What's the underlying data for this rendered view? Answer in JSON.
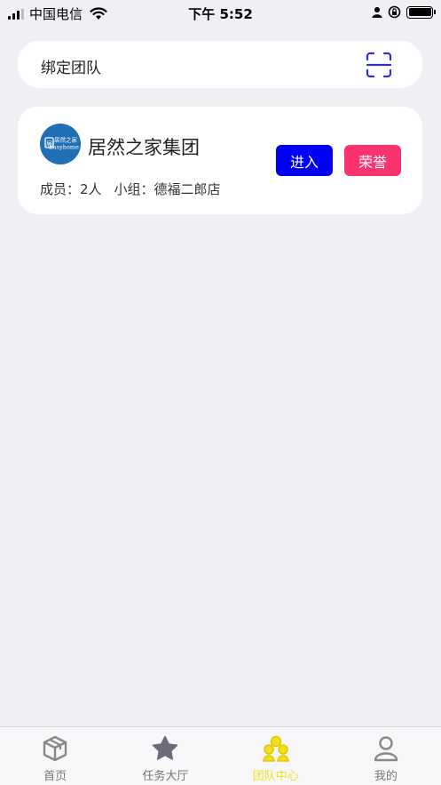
{
  "status_bar": {
    "carrier": "中国电信",
    "time": "下午 5:52"
  },
  "bind_bar": {
    "label": "绑定团队",
    "icon": "scan-icon"
  },
  "team": {
    "name": "居然之家集团",
    "logo_text": "居然之家",
    "logo_subtext": "Easyhome",
    "members": "成员：2人",
    "group": "小组：德福二郎店",
    "enter_label": "进入",
    "honor_label": "荣誉"
  },
  "colors": {
    "accent_blue": "#0000f5",
    "honor_pink": "#fa336e",
    "active_tab": "#f2de1a",
    "scan_icon": "#2b34c9"
  },
  "tab_bar": {
    "items": [
      {
        "label": "首页",
        "icon": "box-icon"
      },
      {
        "label": "任务大厅",
        "icon": "star-icon"
      },
      {
        "label": "团队中心",
        "icon": "team-icon",
        "active": true
      },
      {
        "label": "我的",
        "icon": "user-icon"
      }
    ]
  }
}
